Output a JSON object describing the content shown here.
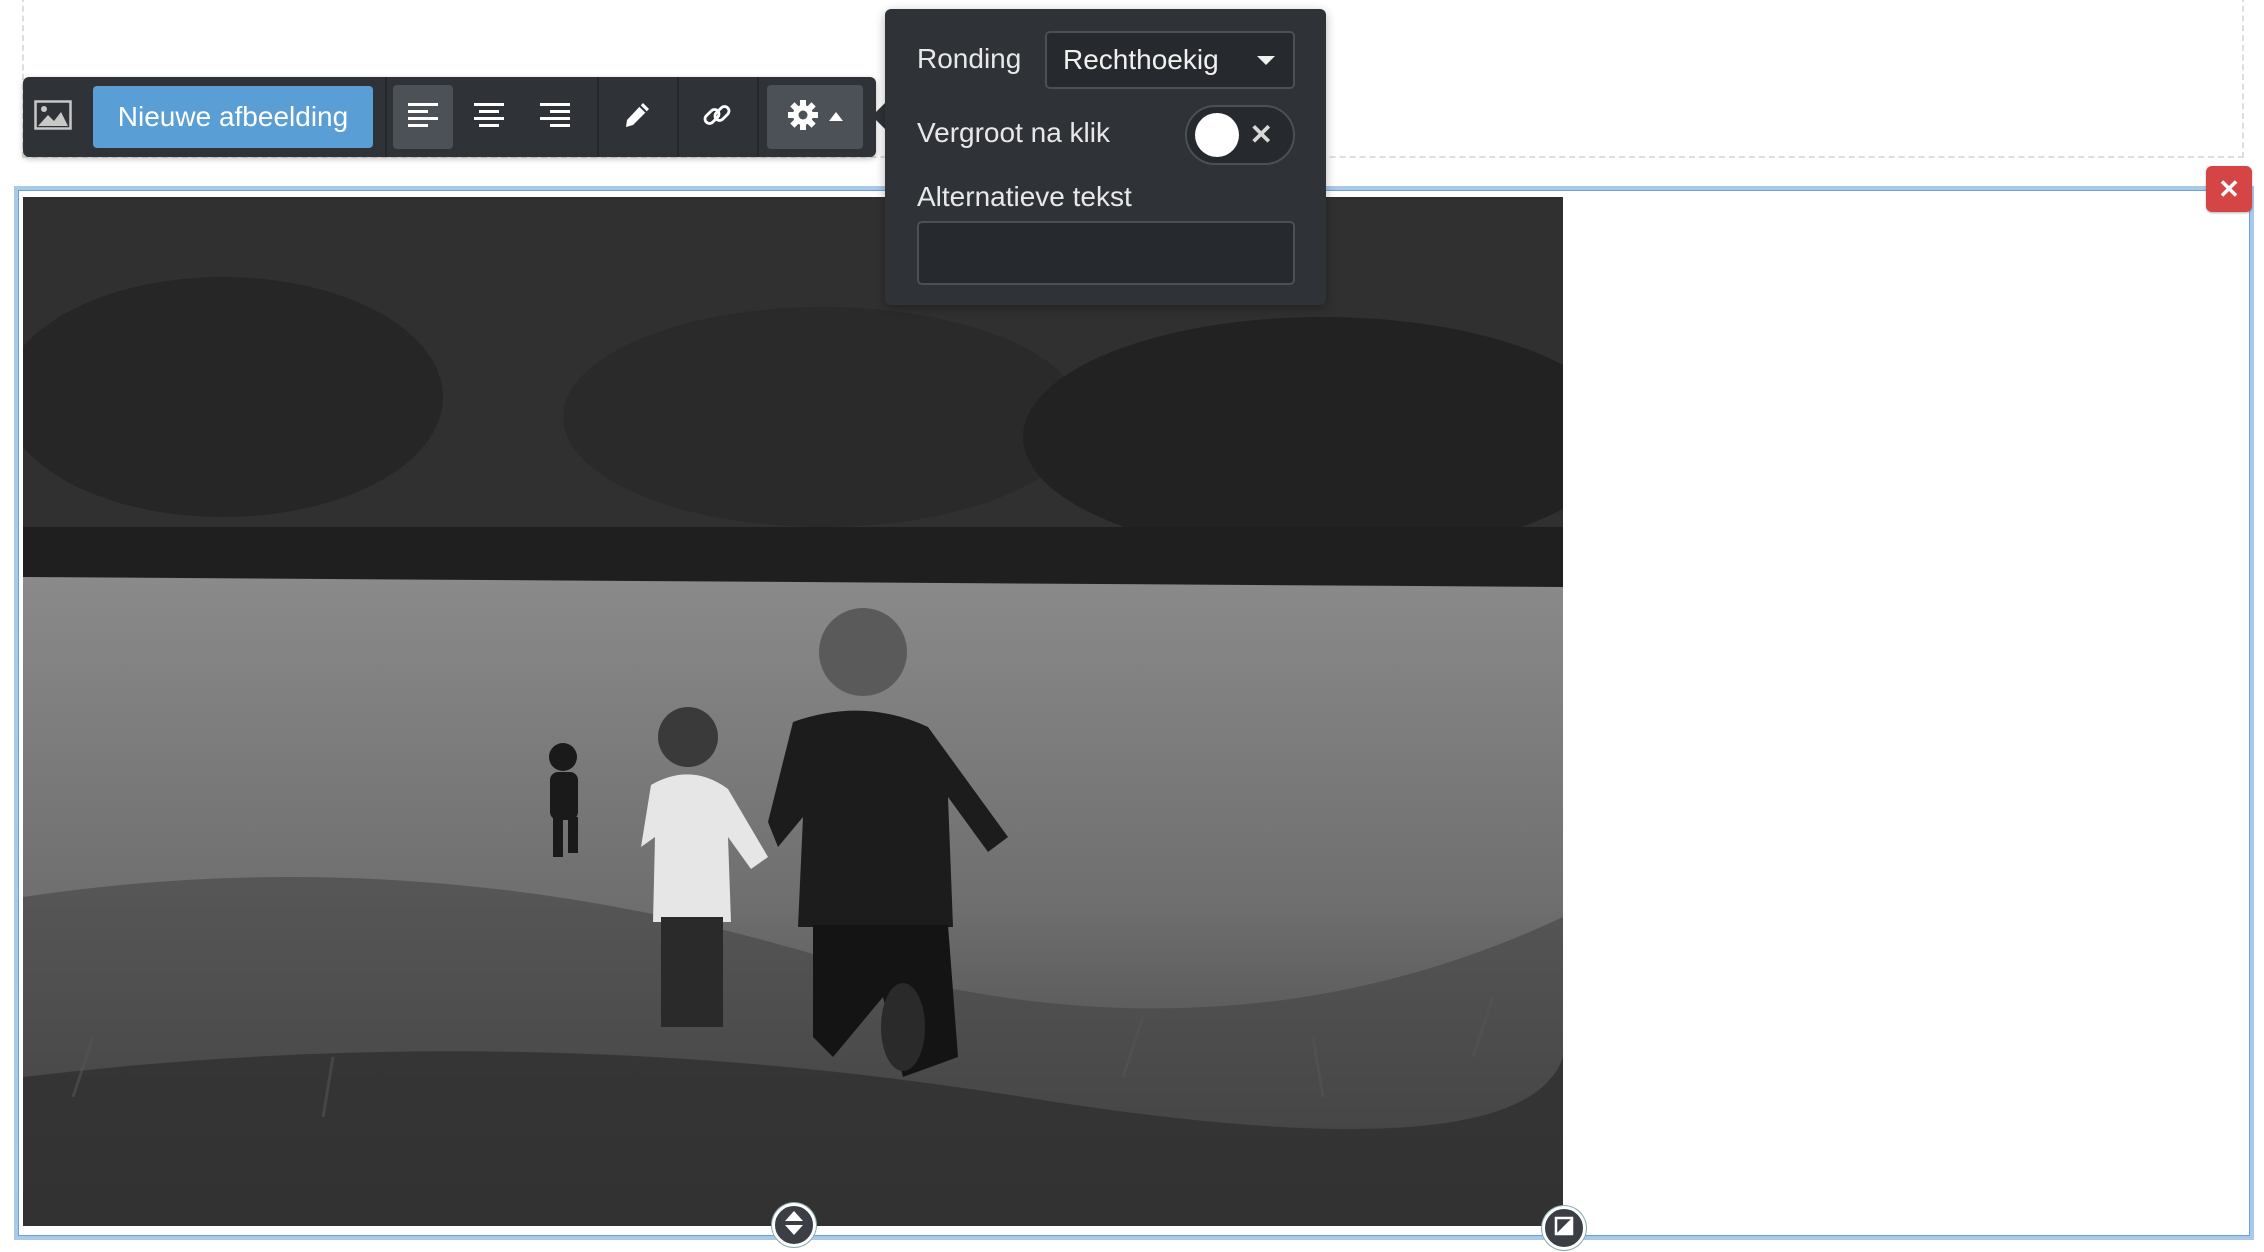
{
  "toolbar": {
    "new_image_label": "Nieuwe afbeelding",
    "icons": [
      "image-icon",
      "align-left-icon",
      "align-center-icon",
      "align-right-icon",
      "pencil-icon",
      "link-icon",
      "gear-icon",
      "caret-up-icon"
    ],
    "active_alignment": "left"
  },
  "settings": {
    "rounding_label": "Ronding",
    "rounding_value": "Rechthoekig",
    "enlarge_label": "Vergroot na klik",
    "enlarge_enabled": false,
    "enlarge_toggle_symbol": "✕",
    "alt_text_label": "Alternatieve tekst",
    "alt_text_value": ""
  },
  "image_block": {
    "delete_symbol": "✕",
    "photo_description": "black and white photo of three children running through a grassy field"
  },
  "colors": {
    "toolbar_bg": "#2f3338",
    "primary_button": "#5a9ed6",
    "delete_button": "#d64545",
    "selection_border": "#a9c9e9"
  }
}
